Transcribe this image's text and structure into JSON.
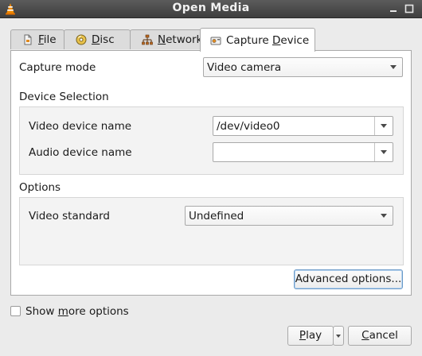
{
  "window": {
    "title": "Open Media"
  },
  "tabs": [
    {
      "pre": "",
      "key": "F",
      "post": "ile",
      "icon": "file-icon"
    },
    {
      "pre": "",
      "key": "D",
      "post": "isc",
      "icon": "disc-icon"
    },
    {
      "pre": "",
      "key": "N",
      "post": "etwork",
      "icon": "network-icon"
    },
    {
      "pre": "Capture ",
      "key": "D",
      "post": "evice",
      "icon": "capture-device-icon",
      "active": true
    }
  ],
  "capture_mode": {
    "label": "Capture mode",
    "value": "Video camera"
  },
  "device_selection": {
    "heading": "Device Selection",
    "video_label": "Video device name",
    "video_value": "/dev/video0",
    "audio_label": "Audio device name",
    "audio_value": ""
  },
  "options": {
    "heading": "Options",
    "standard_label": "Video standard",
    "standard_value": "Undefined",
    "advanced_label": "Advanced options..."
  },
  "footer": {
    "show_more_pre": "Show ",
    "show_more_key": "m",
    "show_more_post": "ore options",
    "play_pre": "",
    "play_key": "P",
    "play_post": "lay",
    "cancel_pre": "",
    "cancel_key": "C",
    "cancel_post": "ancel"
  }
}
